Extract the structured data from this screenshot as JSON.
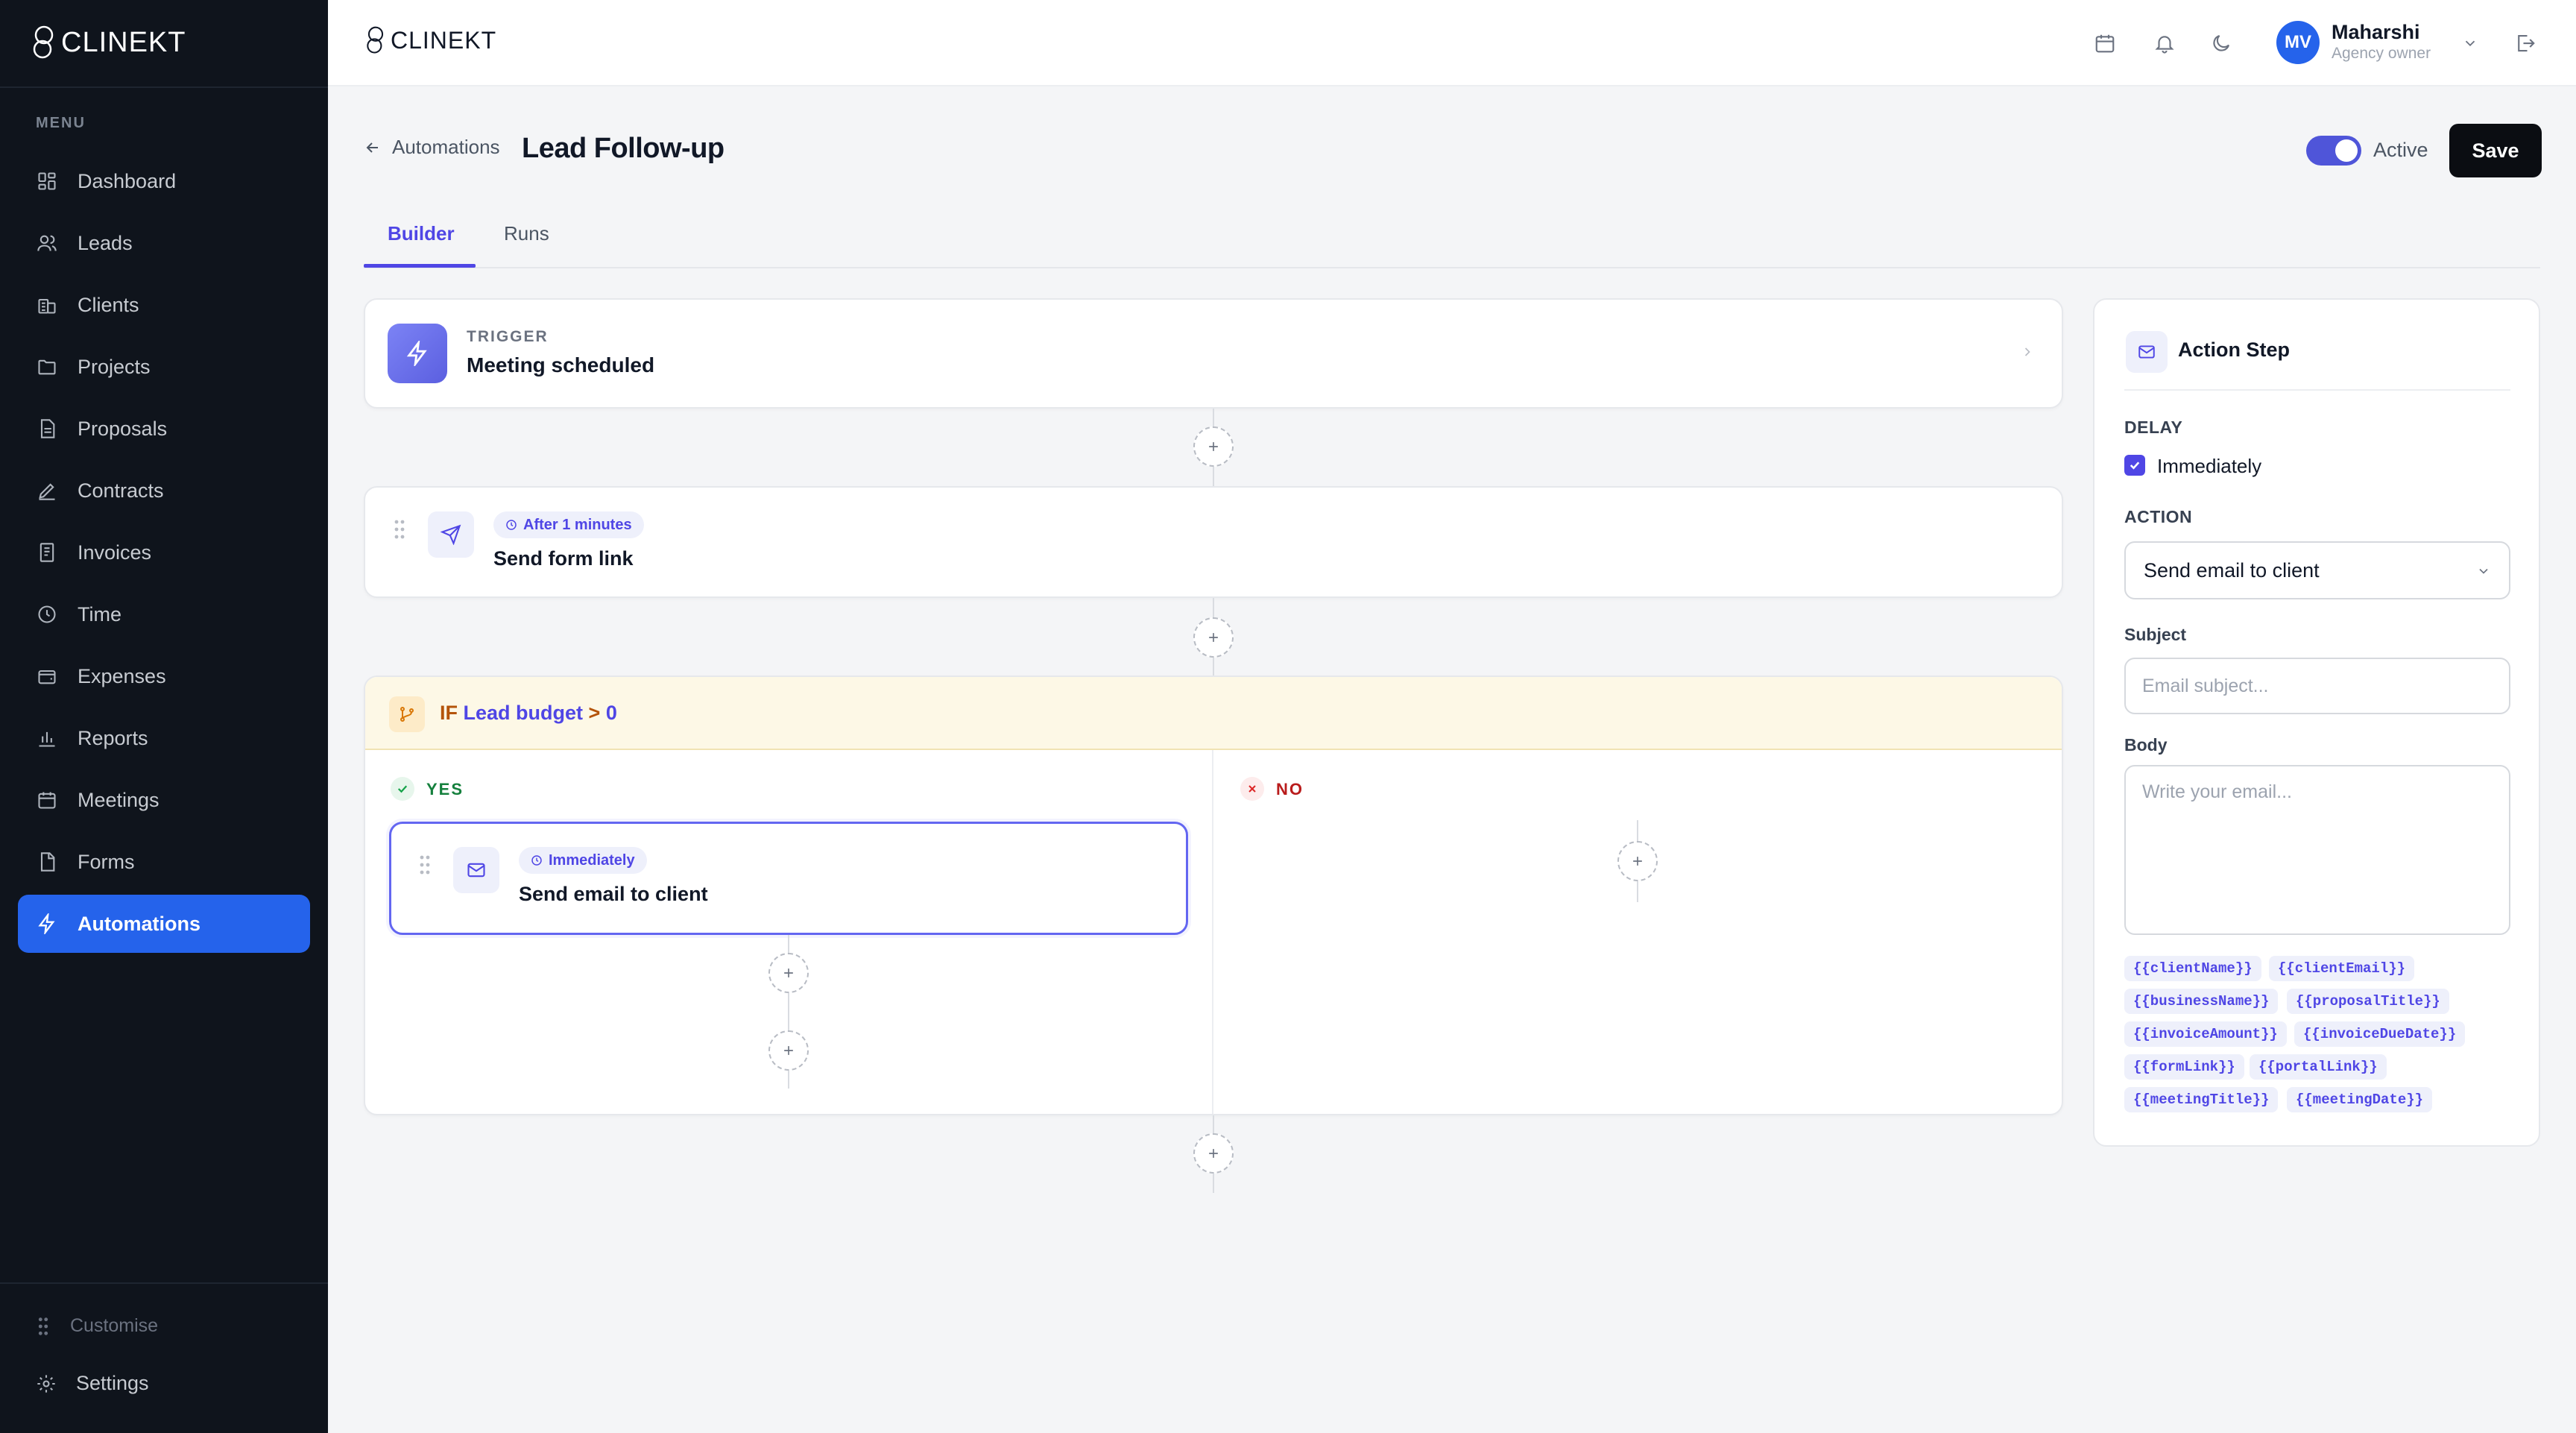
{
  "brand": {
    "name": "CLINEKT"
  },
  "sidebar": {
    "menu_label": "MENU",
    "items": [
      {
        "label": "Dashboard",
        "icon": "dashboard-icon"
      },
      {
        "label": "Leads",
        "icon": "users-icon"
      },
      {
        "label": "Clients",
        "icon": "building-icon"
      },
      {
        "label": "Projects",
        "icon": "folder-icon"
      },
      {
        "label": "Proposals",
        "icon": "document-icon"
      },
      {
        "label": "Contracts",
        "icon": "pen-icon"
      },
      {
        "label": "Invoices",
        "icon": "invoice-icon"
      },
      {
        "label": "Time",
        "icon": "clock-icon"
      },
      {
        "label": "Expenses",
        "icon": "wallet-icon"
      },
      {
        "label": "Reports",
        "icon": "bar-chart-icon"
      },
      {
        "label": "Meetings",
        "icon": "calendar-icon"
      },
      {
        "label": "Forms",
        "icon": "form-icon"
      },
      {
        "label": "Automations",
        "icon": "lightning-icon",
        "active": true
      }
    ],
    "customise_label": "Customise",
    "settings_label": "Settings"
  },
  "topbar": {
    "user": {
      "initials": "MV",
      "name": "Maharshi",
      "role": "Agency owner"
    }
  },
  "header": {
    "back_label": "Automations",
    "title": "Lead Follow-up",
    "toggle_label": "Active",
    "toggle_on": true,
    "save_label": "Save"
  },
  "tabs": [
    {
      "label": "Builder",
      "active": true
    },
    {
      "label": "Runs",
      "active": false
    }
  ],
  "builder": {
    "trigger": {
      "kicker": "TRIGGER",
      "title": "Meeting scheduled"
    },
    "step1": {
      "delay_pill": "After 1 minutes",
      "title": "Send form link"
    },
    "condition": {
      "prefix": "IF",
      "field": "Lead budget",
      "operator": ">",
      "value": "0"
    },
    "yes_label": "YES",
    "no_label": "NO",
    "yes_step": {
      "delay_pill": "Immediately",
      "title": "Send email to client"
    }
  },
  "panel": {
    "title": "Action Step",
    "delay_label": "DELAY",
    "delay_option": "Immediately",
    "delay_checked": true,
    "action_label": "ACTION",
    "action_value": "Send email to client",
    "subject_label": "Subject",
    "subject_placeholder": "Email subject...",
    "body_label": "Body",
    "body_placeholder": "Write your email...",
    "variables": [
      "{{clientName}}",
      "{{clientEmail}}",
      "{{businessName}}",
      "{{proposalTitle}}",
      "{{invoiceAmount}}",
      "{{invoiceDueDate}}",
      "{{formLink}}",
      "{{portalLink}}",
      "{{meetingTitle}}",
      "{{meetingDate}}"
    ]
  },
  "colors": {
    "accent": "#4f46e5",
    "sidebar_bg": "#0f141c",
    "active_item": "#2563eb",
    "condition_bg": "#fdf8e6"
  }
}
